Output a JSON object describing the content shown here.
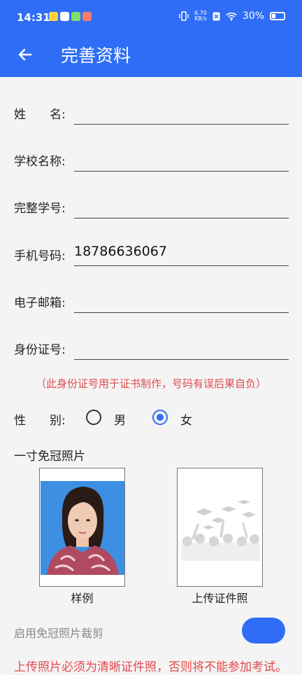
{
  "status_bar": {
    "time": "14:31",
    "net_speed_value": "6.70",
    "net_speed_unit": "KB/s",
    "battery": "30%"
  },
  "header": {
    "title": "完善资料"
  },
  "form": {
    "name_label": "姓　　名:",
    "name_value": "",
    "school_label": "学校名称:",
    "school_value": "",
    "student_id_label": "完整学号:",
    "student_id_value": "",
    "phone_label": "手机号码:",
    "phone_value": "18786636067",
    "email_label": "电子邮箱:",
    "email_value": "",
    "id_card_label": "身份证号:",
    "id_card_value": ""
  },
  "id_notice": "（此身份证号用于证书制作，号码有误后果自负）",
  "gender": {
    "label": "性　　别:",
    "male": "男",
    "female": "女",
    "selected": "女"
  },
  "photo": {
    "section_title": "一寸免冠照片",
    "sample_caption": "样例",
    "upload_caption": "上传证件照"
  },
  "crop": {
    "label": "启用免冠照片裁剪",
    "enabled": true
  },
  "warning": "上传照片必须为清晰证件照，否则将不能参加考试。",
  "colors": {
    "primary": "#2f6df6",
    "warning_red": "#e24a4a",
    "background": "#f4f4f5"
  }
}
